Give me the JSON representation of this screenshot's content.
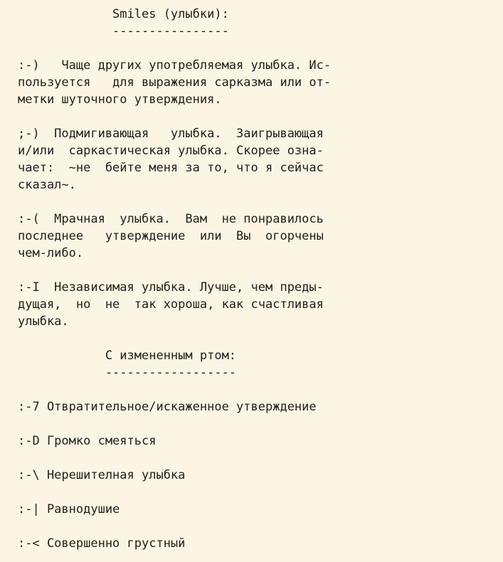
{
  "document": {
    "type": "plain-text-document",
    "encoding_note": "monospace russian emoticon reference",
    "colors": {
      "background": "#fbf5e3",
      "text": "#23211c"
    },
    "sections": [
      {
        "id": "smiles",
        "heading": "             Smiles (улыбки):",
        "rule": "             ----------------",
        "entries": [
          {
            "emoticon": ":-)",
            "bold": false,
            "lines": [
              ":-)   Чаще других употребляемая улыбка. Ис-",
              "пользуется   для выражения сарказма или от-",
              "метки шуточного утверждения."
            ]
          },
          {
            "emoticon": ";-)",
            "bold": false,
            "lines": [
              ";-)  Подмигивающая   улыбка.  Заигрывающая",
              "и/или  саркастическая улыбка. Скорее озна-",
              "чает:  ~не  бейте меня за то, что я сейчас",
              "сказал~."
            ]
          },
          {
            "emoticon": ":-(",
            "bold": false,
            "lines": [
              ":-(  Мрачная  улыбка.  Вам  не понравилось",
              "последнее   утверждение  или  Вы  огорчены",
              "чем-либо."
            ]
          },
          {
            "emoticon": ":-I",
            "bold": true,
            "lines": [
              ":-I  Независимая улыбка. Лучше, чем преды-",
              "дущая,  но  не  так хороша, как счастливая",
              "улыбка."
            ]
          }
        ]
      },
      {
        "id": "changed-mouth",
        "heading": "            С измененным ртом:",
        "rule": "            ------------------",
        "entries": [
          {
            "emoticon": ":-7",
            "bold": false,
            "lines": [
              ":-7 Отвратительное/искаженное утверждение"
            ]
          },
          {
            "emoticon": ":-D",
            "bold": false,
            "lines": [
              ":-D Громко смеяться"
            ]
          },
          {
            "emoticon": ":-\\",
            "bold": false,
            "lines": [
              ":-\\ Нерешителная улыбка"
            ]
          },
          {
            "emoticon": ":-|",
            "bold": false,
            "lines": [
              ":-| Равнодушие"
            ]
          },
          {
            "emoticon": ":-<",
            "bold": false,
            "lines": [
              ":-< Совершенно грустный"
            ]
          }
        ]
      }
    ]
  }
}
